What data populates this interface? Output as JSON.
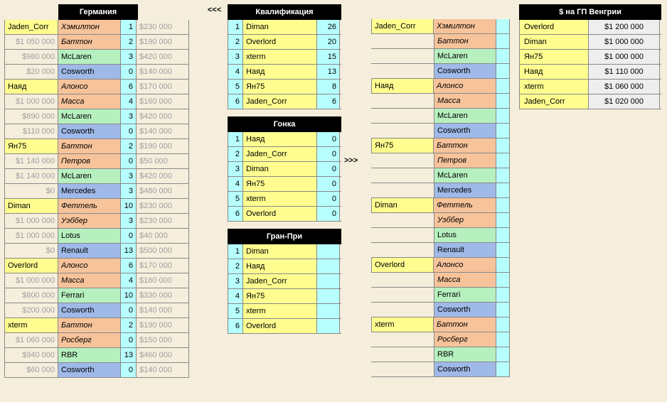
{
  "arrows": {
    "left": "<<<",
    "right": ">>>"
  },
  "germany": {
    "title": "Германия",
    "groups": [
      {
        "owner": "Jaden_Corr",
        "rows": [
          {
            "money": "",
            "name": "Хэмилтон",
            "cls": "cOrange",
            "it": true,
            "pts": "1",
            "cost": "$230 000"
          },
          {
            "money": "$1 050 000",
            "name": "Баттон",
            "cls": "cOrange",
            "it": true,
            "pts": "2",
            "cost": "$190 000"
          },
          {
            "money": "$980 000",
            "name": "McLaren",
            "cls": "cGreen",
            "it": false,
            "pts": "3",
            "cost": "$420 000"
          },
          {
            "money": "$20 000",
            "name": "Cosworth",
            "cls": "cBlue",
            "it": false,
            "pts": "0",
            "cost": "$140 000"
          }
        ]
      },
      {
        "owner": "Наяд",
        "rows": [
          {
            "money": "",
            "name": "Алонсо",
            "cls": "cOrange",
            "it": true,
            "pts": "6",
            "cost": "$170 000"
          },
          {
            "money": "$1 000 000",
            "name": "Масса",
            "cls": "cOrange",
            "it": true,
            "pts": "4",
            "cost": "$160 000"
          },
          {
            "money": "$890 000",
            "name": "McLaren",
            "cls": "cGreen",
            "it": false,
            "pts": "3",
            "cost": "$420 000"
          },
          {
            "money": "$110 000",
            "name": "Cosworth",
            "cls": "cBlue",
            "it": false,
            "pts": "0",
            "cost": "$140 000"
          }
        ]
      },
      {
        "owner": "Ян75",
        "rows": [
          {
            "money": "",
            "name": "Баттон",
            "cls": "cOrange",
            "it": true,
            "pts": "2",
            "cost": "$190 000"
          },
          {
            "money": "$1 140 000",
            "name": "Петров",
            "cls": "cOrange",
            "it": true,
            "pts": "0",
            "cost": "$50 000"
          },
          {
            "money": "$1 140 000",
            "name": "McLaren",
            "cls": "cGreen",
            "it": false,
            "pts": "3",
            "cost": "$420 000"
          },
          {
            "money": "$0",
            "name": "Mercedes",
            "cls": "cBlue",
            "it": false,
            "pts": "3",
            "cost": "$480 000"
          }
        ]
      },
      {
        "owner": "Diman",
        "rows": [
          {
            "money": "",
            "name": "Феттель",
            "cls": "cOrange",
            "it": true,
            "pts": "10",
            "cost": "$230 000"
          },
          {
            "money": "$1 000 000",
            "name": "Уэббер",
            "cls": "cOrange",
            "it": true,
            "pts": "3",
            "cost": "$230 000"
          },
          {
            "money": "$1 000 000",
            "name": "Lotus",
            "cls": "cGreen",
            "it": false,
            "pts": "0",
            "cost": "$40 000"
          },
          {
            "money": "$0",
            "name": "Renault",
            "cls": "cBlue",
            "it": false,
            "pts": "13",
            "cost": "$500 000"
          }
        ]
      },
      {
        "owner": "Overlord",
        "rows": [
          {
            "money": "",
            "name": "Алонсо",
            "cls": "cOrange",
            "it": true,
            "pts": "6",
            "cost": "$170 000"
          },
          {
            "money": "$1 000 000",
            "name": "Масса",
            "cls": "cOrange",
            "it": true,
            "pts": "4",
            "cost": "$160 000"
          },
          {
            "money": "$800 000",
            "name": "Ferrari",
            "cls": "cGreen",
            "it": false,
            "pts": "10",
            "cost": "$330 000"
          },
          {
            "money": "$200 000",
            "name": "Cosworth",
            "cls": "cBlue",
            "it": false,
            "pts": "0",
            "cost": "$140 000"
          }
        ]
      },
      {
        "owner": "xterm",
        "rows": [
          {
            "money": "",
            "name": "Баттон",
            "cls": "cOrange",
            "it": true,
            "pts": "2",
            "cost": "$190 000"
          },
          {
            "money": "$1 060 000",
            "name": "Росберг",
            "cls": "cOrange",
            "it": true,
            "pts": "0",
            "cost": "$150 000"
          },
          {
            "money": "$940 000",
            "name": "RBR",
            "cls": "cGreen",
            "it": false,
            "pts": "13",
            "cost": "$460 000"
          },
          {
            "money": "$60 000",
            "name": "Cosworth",
            "cls": "cBlue",
            "it": false,
            "pts": "0",
            "cost": "$140 000"
          }
        ]
      }
    ]
  },
  "qual": {
    "title": "Квалификация",
    "rows": [
      {
        "r": "1",
        "n": "Diman",
        "p": "26"
      },
      {
        "r": "2",
        "n": "Overlord",
        "p": "20"
      },
      {
        "r": "3",
        "n": "xterm",
        "p": "15"
      },
      {
        "r": "4",
        "n": "Наяд",
        "p": "13"
      },
      {
        "r": "5",
        "n": "Ян75",
        "p": "8"
      },
      {
        "r": "6",
        "n": "Jaden_Corr",
        "p": "6"
      }
    ]
  },
  "race": {
    "title": "Гонка",
    "rows": [
      {
        "r": "1",
        "n": "Наяд",
        "p": "0"
      },
      {
        "r": "2",
        "n": "Jaden_Corr",
        "p": "0"
      },
      {
        "r": "3",
        "n": "Diman",
        "p": "0"
      },
      {
        "r": "4",
        "n": "Ян75",
        "p": "0"
      },
      {
        "r": "5",
        "n": "xterm",
        "p": "0"
      },
      {
        "r": "6",
        "n": "Overlord",
        "p": "0"
      }
    ]
  },
  "gp": {
    "title": "Гран-При",
    "rows": [
      {
        "r": "1",
        "n": "Diman",
        "p": ""
      },
      {
        "r": "2",
        "n": "Наяд",
        "p": ""
      },
      {
        "r": "3",
        "n": "Jaden_Corr",
        "p": ""
      },
      {
        "r": "4",
        "n": "Ян75",
        "p": ""
      },
      {
        "r": "5",
        "n": "xterm",
        "p": ""
      },
      {
        "r": "6",
        "n": "Overlord",
        "p": ""
      }
    ]
  },
  "right": {
    "groups": [
      {
        "owner": "Jaden_Corr",
        "rows": [
          {
            "name": "Хэмилтон",
            "cls": "cOrange",
            "it": true
          },
          {
            "name": "Баттон",
            "cls": "cOrange",
            "it": true
          },
          {
            "name": "McLaren",
            "cls": "cGreen",
            "it": false
          },
          {
            "name": "Cosworth",
            "cls": "cBlue",
            "it": false
          }
        ]
      },
      {
        "owner": "Наяд",
        "rows": [
          {
            "name": "Алонсо",
            "cls": "cOrange",
            "it": true
          },
          {
            "name": "Масса",
            "cls": "cOrange",
            "it": true
          },
          {
            "name": "McLaren",
            "cls": "cGreen",
            "it": false
          },
          {
            "name": "Cosworth",
            "cls": "cBlue",
            "it": false
          }
        ]
      },
      {
        "owner": "Ян75",
        "rows": [
          {
            "name": "Баттон",
            "cls": "cOrange",
            "it": true
          },
          {
            "name": "Петров",
            "cls": "cOrange",
            "it": true
          },
          {
            "name": "McLaren",
            "cls": "cGreen",
            "it": false
          },
          {
            "name": "Mercedes",
            "cls": "cBlue",
            "it": false
          }
        ]
      },
      {
        "owner": "Diman",
        "rows": [
          {
            "name": "Феттель",
            "cls": "cOrange",
            "it": true
          },
          {
            "name": "Уэббер",
            "cls": "cOrange",
            "it": true
          },
          {
            "name": "Lotus",
            "cls": "cGreen",
            "it": false
          },
          {
            "name": "Renault",
            "cls": "cBlue",
            "it": false
          }
        ]
      },
      {
        "owner": "Overlord",
        "rows": [
          {
            "name": "Алонсо",
            "cls": "cOrange",
            "it": true
          },
          {
            "name": "Масса",
            "cls": "cOrange",
            "it": true
          },
          {
            "name": "Ferrari",
            "cls": "cGreen",
            "it": false
          },
          {
            "name": "Cosworth",
            "cls": "cBlue",
            "it": false
          }
        ]
      },
      {
        "owner": "xterm",
        "rows": [
          {
            "name": "Баттон",
            "cls": "cOrange",
            "it": true
          },
          {
            "name": "Росберг",
            "cls": "cOrange",
            "it": true
          },
          {
            "name": "RBR",
            "cls": "cGreen",
            "it": false
          },
          {
            "name": "Cosworth",
            "cls": "cBlue",
            "it": false
          }
        ]
      }
    ]
  },
  "budget": {
    "title": "$ на ГП Венгрии",
    "rows": [
      {
        "n": "Overlord",
        "v": "$1 200 000"
      },
      {
        "n": "Diman",
        "v": "$1 000 000"
      },
      {
        "n": "Ян75",
        "v": "$1 000 000"
      },
      {
        "n": "Наяд",
        "v": "$1 110 000"
      },
      {
        "n": "xterm",
        "v": "$1 060 000"
      },
      {
        "n": "Jaden_Corr",
        "v": "$1 020 000"
      }
    ]
  }
}
